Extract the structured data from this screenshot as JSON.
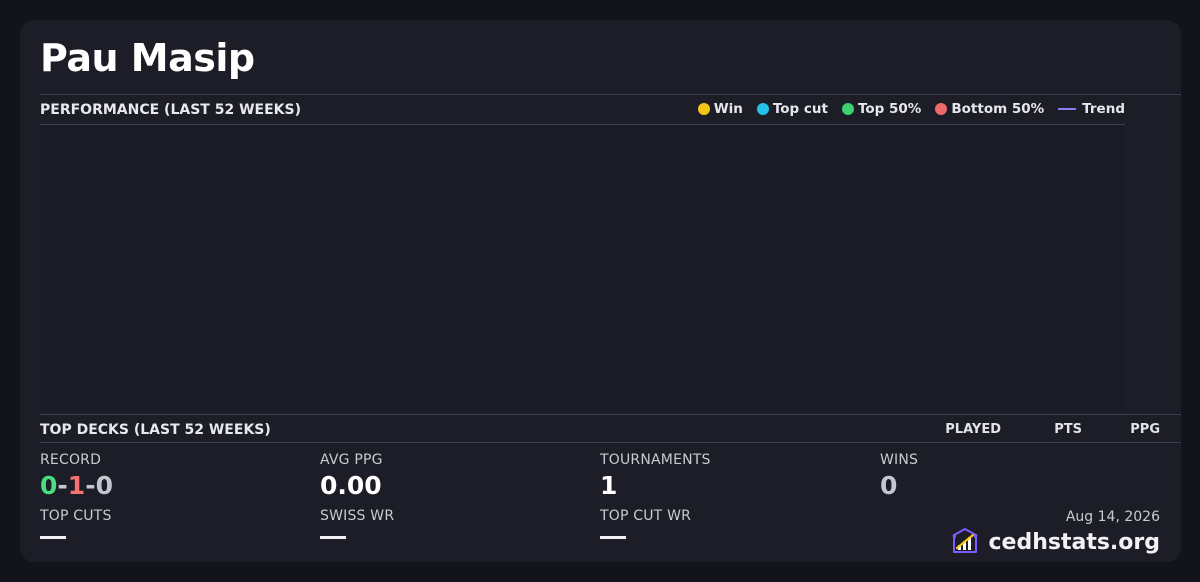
{
  "player": {
    "name": "Pau Masip"
  },
  "performance": {
    "title": "PERFORMANCE (LAST 52 WEEKS)",
    "legend": [
      {
        "label": "Win",
        "color": "#f5c518",
        "kind": "dot",
        "icon": "yellow-dot-icon"
      },
      {
        "label": "Top cut",
        "color": "#22c3e6",
        "kind": "dot",
        "icon": "cyan-dot-icon"
      },
      {
        "label": "Top 50%",
        "color": "#3ecf6e",
        "kind": "dot",
        "icon": "green-dot-icon"
      },
      {
        "label": "Bottom 50%",
        "color": "#ef6b6b",
        "kind": "dot",
        "icon": "red-dot-icon"
      },
      {
        "label": "Trend",
        "color": "#8b7cf6",
        "kind": "line",
        "icon": "trend-line-icon"
      }
    ]
  },
  "top_decks": {
    "title": "TOP DECKS (LAST 52 WEEKS)",
    "columns": [
      "PLAYED",
      "PTS",
      "PPG"
    ]
  },
  "stats": {
    "record": {
      "label": "RECORD",
      "wins": "0",
      "losses": "1",
      "draws": "0",
      "sep": "-",
      "win_color": "#4ade80",
      "loss_color": "#f87171"
    },
    "avg_ppg": {
      "label": "AVG PPG",
      "value": "0.00"
    },
    "tournaments": {
      "label": "TOURNAMENTS",
      "value": "1"
    },
    "wins": {
      "label": "WINS",
      "value": "0"
    },
    "top_cuts": {
      "label": "TOP CUTS",
      "value": "—"
    },
    "swiss_wr": {
      "label": "SWISS WR",
      "value": "—"
    },
    "top_cut_wr": {
      "label": "TOP CUT WR",
      "value": "—"
    }
  },
  "footer": {
    "date": "Aug 14, 2026",
    "brand": "cedhstats.org",
    "logo_icon": "cedhstats-logo-icon"
  },
  "colors": {
    "background": "#131419",
    "card": "#1c1d27",
    "divider": "#3d4050",
    "accent": "#7c5cff"
  }
}
